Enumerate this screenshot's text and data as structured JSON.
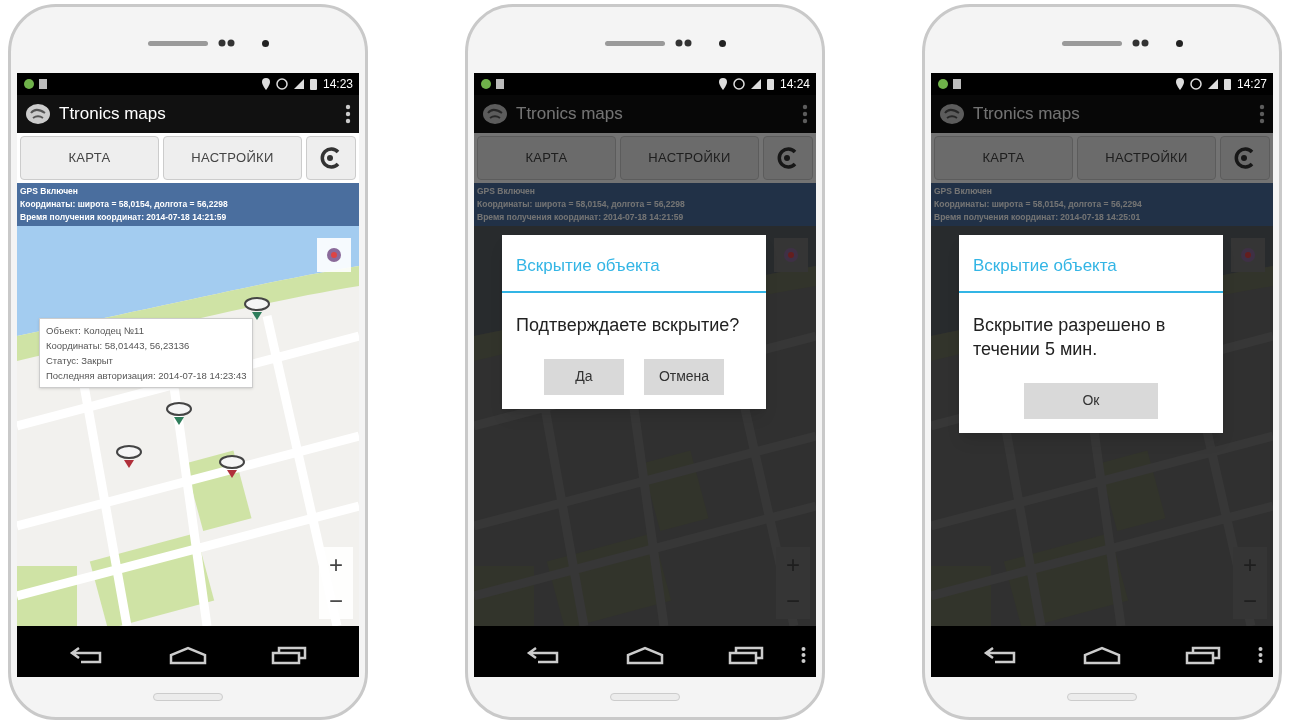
{
  "phones": [
    {
      "status_time": "14:23",
      "app_title": "Ttronics maps",
      "tabs": [
        "КАРТА",
        "НАСТРОЙКИ"
      ],
      "info": [
        "GPS Включен",
        "Координаты: широта = 58,0154, долгота = 56,2298",
        "Время получения координат:  2014-07-18 14:21:59"
      ],
      "map": {
        "kind": "light",
        "zoom_in": "+",
        "zoom_out": "−",
        "markers": [
          {
            "color": "#2e7d5b"
          },
          {
            "color": "#2e7d5b"
          },
          {
            "color": "#b0303a"
          },
          {
            "color": "#b0303a"
          }
        ],
        "popup": [
          "Объект: Колодец №11",
          "Координаты: 58,01443, 56,23136",
          "Статус: Закрыт",
          "Последняя авторизация: 2014-07-18 14:23:43"
        ]
      },
      "nav_menu": false
    },
    {
      "status_time": "14:24",
      "app_title": "Ttronics maps",
      "tabs": [
        "КАРТА",
        "НАСТРОЙКИ"
      ],
      "info": [
        "GPS Включен",
        "Координаты: широта = 58,0154, долгота = 56,2298",
        "Время получения координат:  2014-07-18 14:21:59"
      ],
      "map": {
        "kind": "dark",
        "zoom_in": "+",
        "zoom_out": "−"
      },
      "dialog": {
        "title": "Вскрытие объекта",
        "message": "Подтверждаете вскрытие?",
        "buttons": [
          "Да",
          "Отмена"
        ]
      },
      "nav_menu": true
    },
    {
      "status_time": "14:27",
      "app_title": "Ttronics maps",
      "tabs": [
        "КАРТА",
        "НАСТРОЙКИ"
      ],
      "info": [
        "GPS Включен",
        "Координаты: широта = 58,0154, долгота = 56,2294",
        "Время получения координат:  2014-07-18 14:25:01"
      ],
      "map": {
        "kind": "dark",
        "zoom_in": "+",
        "zoom_out": "−"
      },
      "dialog": {
        "title": "Вскрытие объекта",
        "message": "Вскрытие разрешено в течении 5 мин.",
        "buttons": [
          "Ок"
        ]
      },
      "nav_menu": true
    }
  ]
}
